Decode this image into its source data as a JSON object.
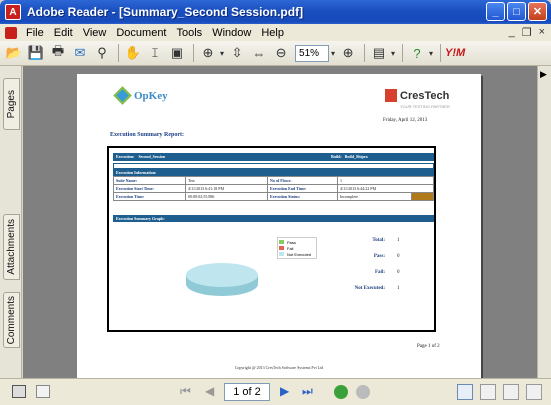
{
  "window": {
    "title": "Adobe Reader - [Summary_Second Session.pdf]",
    "app_icon_glyph": "A"
  },
  "menu": {
    "items": [
      "File",
      "Edit",
      "View",
      "Document",
      "Tools",
      "Window",
      "Help"
    ],
    "controls": [
      "_",
      "×"
    ]
  },
  "toolbar": {
    "zoom_value": "51%"
  },
  "side_tabs": {
    "pages": "Pages",
    "attachments": "Attachments",
    "comments": "Comments"
  },
  "document": {
    "opkey_logo": "OpKey",
    "crestech_logo": "CresTech",
    "crestech_tagline": "YOUR TESTING PARTNER",
    "date": "Friday, April 12, 2013",
    "report_title": "Execution Summary Report:",
    "header": {
      "execution_label": "Execution:",
      "execution_value": "Second_Session",
      "build_label": "Build:",
      "build_value": "Build_Shipra"
    },
    "execution_info_title": "Execution Information:",
    "info_rows": [
      [
        "Suite Name:",
        "Test",
        "No of Flows:",
        "1"
      ],
      [
        "Execution Start Time:",
        "4/11/2013 6:41:18 PM",
        "Execution End Time:",
        "4/11/2013 6:44:22 PM"
      ],
      [
        "Execution Time:",
        "00:00:02:55.886",
        "Execution Status:",
        "Incomplete"
      ]
    ],
    "graph_title": "Execution Summary Graph:",
    "legend": [
      "Pass",
      "Fail",
      "Not Executed"
    ],
    "legend_colors": [
      "#88cc66",
      "#dd6655",
      "#bfe6ee"
    ],
    "stats": [
      {
        "label": "Total:",
        "value": "1"
      },
      {
        "label": "Pass:",
        "value": "0"
      },
      {
        "label": "Fail:",
        "value": "0"
      },
      {
        "label": "Not Executed:",
        "value": "1"
      }
    ],
    "page_number": "Page 1 of 2",
    "copyright": "Copyright @ 2013 CresTech Software Systems Pvt Ltd"
  },
  "statusbar": {
    "page_box": "1 of 2"
  },
  "chart_data": {
    "type": "pie",
    "categories": [
      "Pass",
      "Fail",
      "Not Executed"
    ],
    "values": [
      0,
      0,
      1
    ],
    "title": "Execution Summary Graph:"
  }
}
